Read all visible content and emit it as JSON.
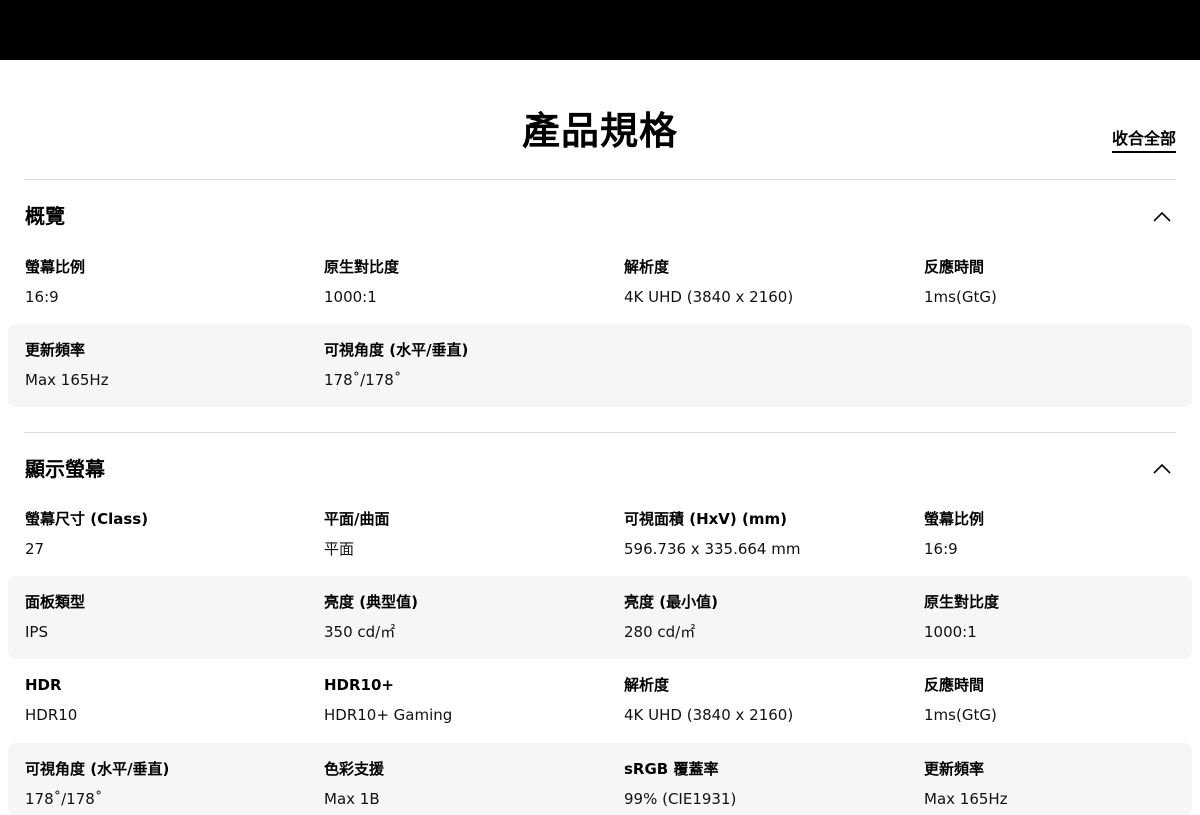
{
  "page": {
    "title": "產品規格",
    "collapse_all": "收合全部"
  },
  "sections": [
    {
      "title": "概覽",
      "rows": [
        [
          {
            "label": "螢幕比例",
            "value": "16:9"
          },
          {
            "label": "原生對比度",
            "value": "1000:1"
          },
          {
            "label": "解析度",
            "value": "4K UHD (3840 x 2160)"
          },
          {
            "label": "反應時間",
            "value": "1ms(GtG)"
          }
        ],
        [
          {
            "label": "更新頻率",
            "value": "Max 165Hz"
          },
          {
            "label": "可視角度 (水平/垂直)",
            "value": "178˚/178˚"
          }
        ]
      ]
    },
    {
      "title": "顯示螢幕",
      "rows": [
        [
          {
            "label": "螢幕尺寸 (Class)",
            "value": "27"
          },
          {
            "label": "平面/曲面",
            "value": "平面"
          },
          {
            "label": "可視面積 (HxV) (mm)",
            "value": "596.736 x 335.664 mm"
          },
          {
            "label": "螢幕比例",
            "value": "16:9"
          }
        ],
        [
          {
            "label": "面板類型",
            "value": "IPS"
          },
          {
            "label": "亮度 (典型值)",
            "value": "350 cd/㎡"
          },
          {
            "label": "亮度 (最小值)",
            "value": "280 cd/㎡"
          },
          {
            "label": "原生對比度",
            "value": "1000:1"
          }
        ],
        [
          {
            "label": "HDR",
            "value": "HDR10"
          },
          {
            "label": "HDR10+",
            "value": "HDR10+ Gaming"
          },
          {
            "label": "解析度",
            "value": "4K UHD (3840 x 2160)"
          },
          {
            "label": "反應時間",
            "value": "1ms(GtG)"
          }
        ],
        [
          {
            "label": "可視角度 (水平/垂直)",
            "value": "178˚/178˚"
          },
          {
            "label": "色彩支援",
            "value": "Max 1B"
          },
          {
            "label": "sRGB 覆蓋率",
            "value": "99% (CIE1931)"
          },
          {
            "label": "更新頻率",
            "value": "Max 165Hz"
          }
        ]
      ]
    }
  ]
}
